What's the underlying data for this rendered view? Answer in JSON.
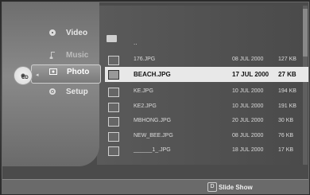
{
  "menu": {
    "items": [
      {
        "label": "Video",
        "icon": "video-icon"
      },
      {
        "label": "Music",
        "icon": "music-icon"
      },
      {
        "label": "Photo",
        "icon": "photo-icon",
        "selected": true
      },
      {
        "label": "Setup",
        "icon": "setup-icon"
      }
    ]
  },
  "device": {
    "disc_label": "CD",
    "disc_icon": "disc-icon",
    "arrow": "◂"
  },
  "browser": {
    "up_label": "..",
    "files": [
      {
        "name": "176.JPG",
        "date": "08 JUL 2000",
        "size": "127 KB"
      },
      {
        "name": "BEACH.JPG",
        "date": "17 JUL 2000",
        "size": "27 KB",
        "selected": true
      },
      {
        "name": "KE.JPG",
        "date": "10 JUL 2000",
        "size": "194 KB"
      },
      {
        "name": "KE2.JPG",
        "date": "10 JUL 2000",
        "size": "191 KB"
      },
      {
        "name": "MBHONG.JPG",
        "date": "20 JUL 2000",
        "size": "30 KB"
      },
      {
        "name": "NEW_BEE.JPG",
        "date": "08 JUL 2000",
        "size": "76 KB"
      },
      {
        "name": "______1_.JPG",
        "date": "18 JUL 2000",
        "size": "17 KB"
      }
    ]
  },
  "footer": {
    "button_label": "D",
    "action_label": "Slide Show"
  }
}
